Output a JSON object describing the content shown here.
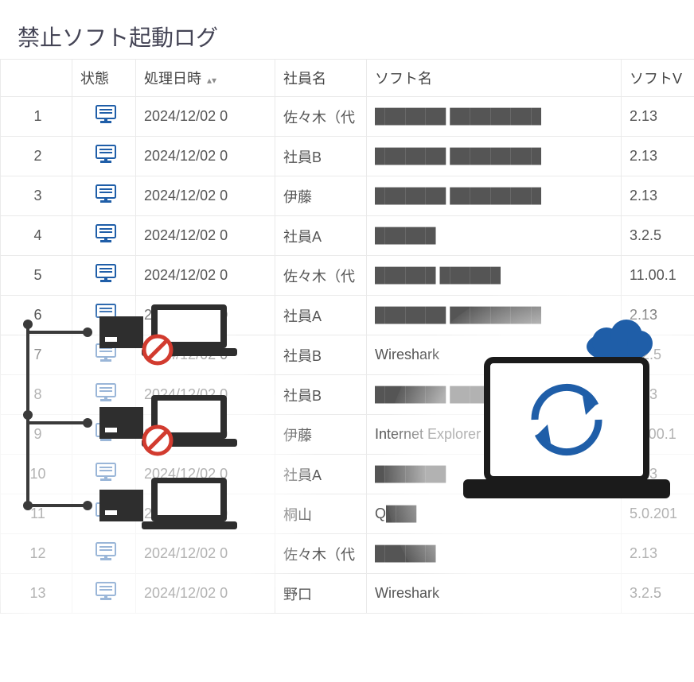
{
  "title": "禁止ソフト起動ログ",
  "columns": {
    "rownum": "",
    "status": "状態",
    "datetime": "処理日時",
    "employee": "社員名",
    "software": "ソフト名",
    "version": "ソフトV"
  },
  "sort_indicator": "▴▾",
  "rows": [
    {
      "n": "1",
      "dt": "2024/12/02 0",
      "emp": "佐々木（代",
      "soft": "███████ █████████",
      "ver": "2.13"
    },
    {
      "n": "2",
      "dt": "2024/12/02 0",
      "emp": "社員B",
      "soft": "███████ █████████",
      "ver": "2.13"
    },
    {
      "n": "3",
      "dt": "2024/12/02 0",
      "emp": "伊藤",
      "soft": "███████ █████████",
      "ver": "2.13"
    },
    {
      "n": "4",
      "dt": "2024/12/02 0",
      "emp": "社員A",
      "soft": "██████",
      "ver": "3.2.5"
    },
    {
      "n": "5",
      "dt": "2024/12/02 0",
      "emp": "佐々木（代",
      "soft": "██████ ██████",
      "ver": "11.00.1"
    },
    {
      "n": "6",
      "dt": "2024/12/02 0",
      "emp": "社員A",
      "soft": "███████ █████████",
      "ver": "2.13"
    },
    {
      "n": "7",
      "dt": "2024/12/02 0",
      "emp": "社員B",
      "soft": "Wireshark",
      "ver": "3.2.5"
    },
    {
      "n": "8",
      "dt": "2024/12/02 0",
      "emp": "社員B",
      "soft": "███████ █████████",
      "ver": "2.13"
    },
    {
      "n": "9",
      "dt": "2024/12/02 0",
      "emp": "伊藤",
      "soft": "Internet Explorer",
      "ver": "11.00.1"
    },
    {
      "n": "10",
      "dt": "2024/12/02 0",
      "emp": "社員A",
      "soft": "███████",
      "ver": "2.13"
    },
    {
      "n": "11",
      "dt": "2024/12/02 0",
      "emp": "桐山",
      "soft": "Q███",
      "ver": "5.0.201"
    },
    {
      "n": "12",
      "dt": "2024/12/02 0",
      "emp": "佐々木（代",
      "soft": "██████",
      "ver": "2.13"
    },
    {
      "n": "13",
      "dt": "2024/12/02 0",
      "emp": "野口",
      "soft": "Wireshark",
      "ver": "3.2.5"
    }
  ]
}
